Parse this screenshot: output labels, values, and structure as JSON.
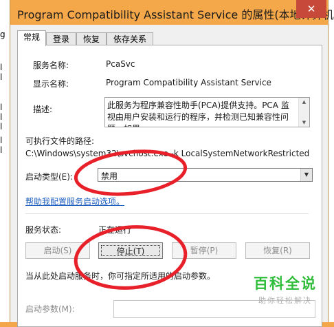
{
  "window": {
    "title": "Program Compatibility Assistant Service 的属性(本地计算机)"
  },
  "left_strip": [
    "g",
    "l",
    "l",
    "l",
    "l",
    "l",
    "l",
    "l"
  ],
  "tabs": [
    "常规",
    "登录",
    "恢复",
    "依存关系"
  ],
  "general": {
    "service_name_label": "服务名称:",
    "service_name_value": "PcaSvc",
    "display_name_label": "显示名称:",
    "display_name_value": "Program Compatibility Assistant Service",
    "description_label": "描述:",
    "description_value": "此服务为程序兼容性助手(PCA)提供支持。PCA 监视由用户安装和运行的程序，并检测已知兼容性问题。如果",
    "exe_path_label": "可执行文件的路径:",
    "exe_path_value": "C:\\Windows\\system32\\svchost.exe -k LocalSystemNetworkRestricted",
    "startup_type_label": "启动类型(E):",
    "startup_type_value": "禁用",
    "help_link": "帮助我配置服务启动选项。",
    "status_label": "服务状态:",
    "status_value": "正在运行",
    "buttons": {
      "start": "启动(S)",
      "stop": "停止(T)",
      "pause": "暂停(P)",
      "resume": "恢复(R)"
    },
    "start_hint": "当从此处启动服务时，你可指定所适用的启动参数。",
    "start_params_label": "启动参数(M):",
    "start_params_value": ""
  },
  "watermark": {
    "main": "百科全说",
    "sub": "助你轻松解决"
  },
  "colors": {
    "annotation_red": "#e8202a",
    "titlebar": "#f5a84a",
    "close_button": "#c7493a",
    "watermark_green": "#2fbd3a"
  }
}
